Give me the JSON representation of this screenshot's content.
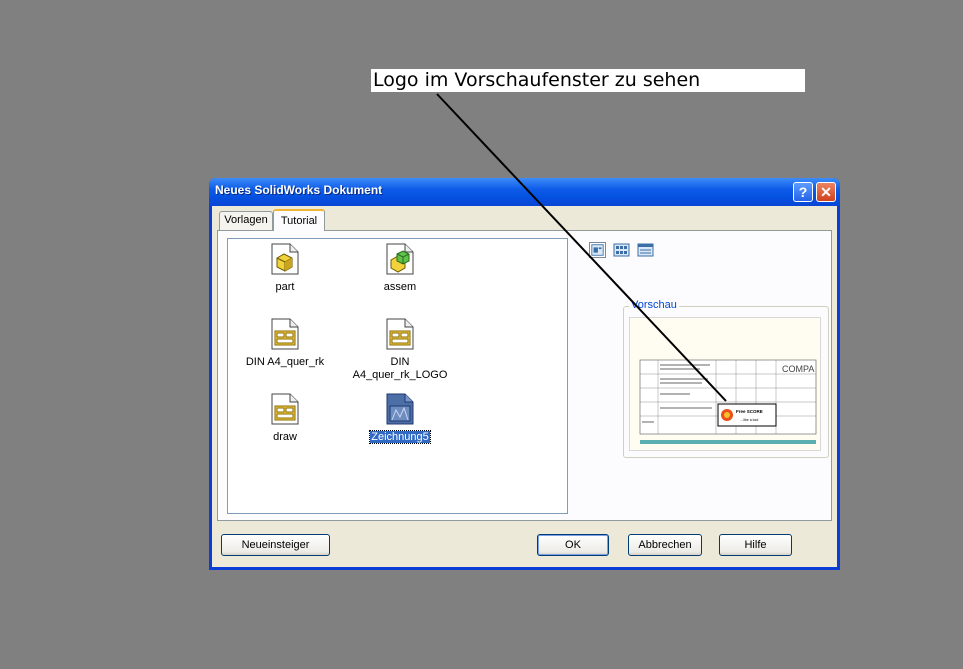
{
  "callout": {
    "text": "Logo im Vorschaufenster zu sehen"
  },
  "dialog": {
    "title": "Neues SolidWorks Dokument",
    "help_glyph": "?",
    "close_glyph": "✕",
    "tabs": [
      {
        "label": "Vorlagen"
      },
      {
        "label": "Tutorial"
      }
    ],
    "files": [
      {
        "label": "part",
        "icon": "part-icon"
      },
      {
        "label": "assem",
        "icon": "assembly-icon"
      },
      {
        "label": "DIN A4_quer_rk",
        "icon": "drawing-template-icon"
      },
      {
        "label": "DIN A4_quer_rk_LOGO",
        "icon": "drawing-template-icon"
      },
      {
        "label": "draw",
        "icon": "drawing-template-icon"
      },
      {
        "label": "Zeichnung5",
        "icon": "drawing-document-icon",
        "selected": true
      }
    ],
    "preview_label": "Vorschau",
    "preview_text": {
      "company": "COMPA",
      "logo_line1": "Free SCORE",
      "logo_line2": "…like a tool"
    },
    "buttons": {
      "beginner": "Neueinsteiger",
      "ok": "OK",
      "cancel": "Abbrechen",
      "help": "Hilfe"
    }
  },
  "colors": {
    "desktop": "#808080",
    "titlebar": "#0550e0",
    "selection": "#316ac5",
    "preview_stripe": "#5ab0b0"
  }
}
